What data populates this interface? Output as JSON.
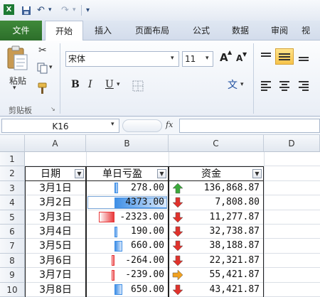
{
  "window": {
    "tabs": [
      "文件",
      "开始",
      "插入",
      "页面布局",
      "公式",
      "数据",
      "审阅",
      "视"
    ]
  },
  "ribbon": {
    "paste_label": "粘贴",
    "clipboard_group": "剪贴板",
    "font_name": "宋体",
    "font_size": "11",
    "grow_font": "A",
    "shrink_font": "A",
    "bold": "B",
    "italic": "I",
    "underline": "U",
    "phonetic": "文"
  },
  "formula_bar": {
    "name_box": "K16",
    "fx": "fx",
    "formula": ""
  },
  "sheet": {
    "columns": [
      "A",
      "B",
      "C",
      "D"
    ],
    "row_numbers": [
      "1",
      "2",
      "3",
      "4",
      "5",
      "6",
      "7",
      "8",
      "9",
      "10"
    ],
    "headers": [
      "日期",
      "单日亏盈",
      "资金"
    ],
    "rows": [
      {
        "date": "3月1日",
        "pl": "278.00",
        "fund": "136,868.87",
        "arrow": "up"
      },
      {
        "date": "3月2日",
        "pl": "4373.00",
        "fund": "7,808.80",
        "arrow": "down"
      },
      {
        "date": "3月3日",
        "pl": "-2323.00",
        "fund": "11,277.87",
        "arrow": "down"
      },
      {
        "date": "3月4日",
        "pl": "190.00",
        "fund": "32,738.87",
        "arrow": "down"
      },
      {
        "date": "3月5日",
        "pl": "660.00",
        "fund": "38,188.87",
        "arrow": "down"
      },
      {
        "date": "3月6日",
        "pl": "-264.00",
        "fund": "22,321.87",
        "arrow": "down"
      },
      {
        "date": "3月7日",
        "pl": "-239.00",
        "fund": "55,421.87",
        "arrow": "right"
      },
      {
        "date": "3月8日",
        "pl": "650.00",
        "fund": "43,421.87",
        "arrow": "down"
      }
    ],
    "colors": {
      "positive_bar": "#3f8fe6",
      "negative_bar": "#e8383a",
      "up_arrow": "#3aa83a",
      "down_arrow": "#e0322c",
      "right_arrow": "#f0a020"
    }
  }
}
